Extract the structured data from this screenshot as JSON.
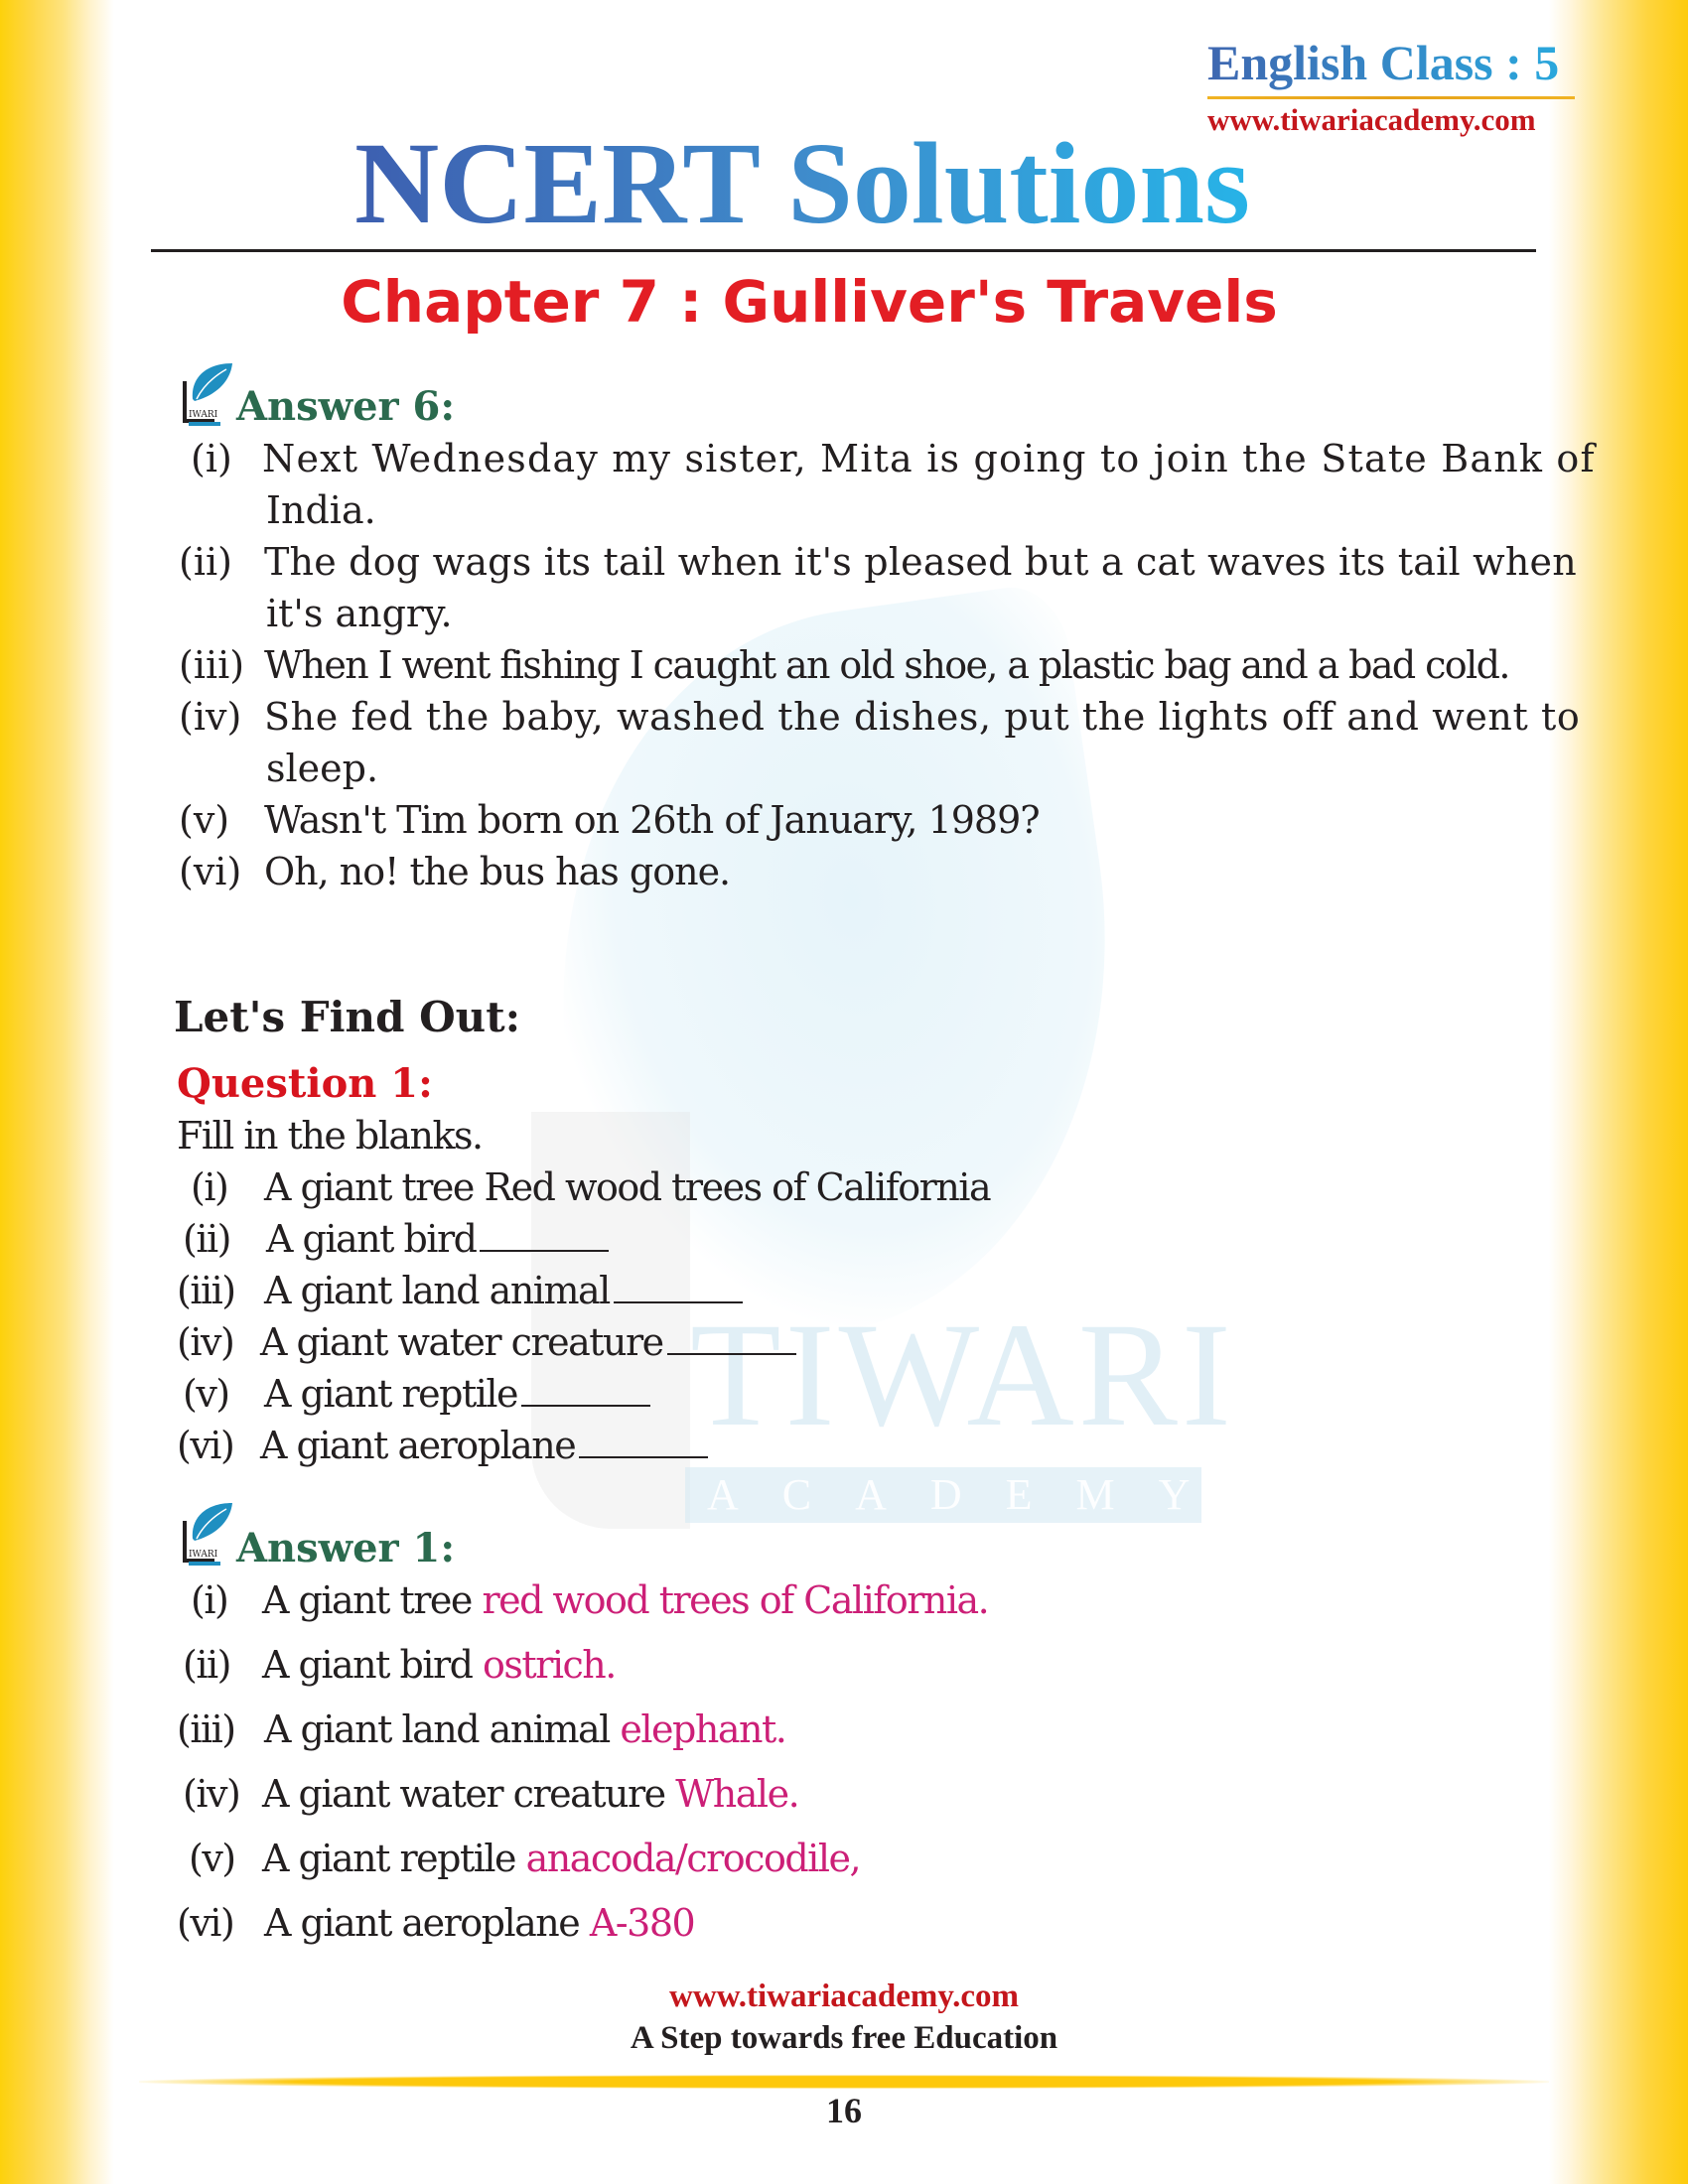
{
  "header": {
    "class_label": "English Class : 5",
    "website": "www.tiwariacademy.com",
    "title": "NCERT Solutions",
    "chapter": "Chapter 7 : Gulliver's Travels"
  },
  "answer6": {
    "heading": "Answer 6:",
    "logo_label": "TIWARI",
    "items": [
      {
        "num": "(i)",
        "line1": "Next Wednesday my sister, Mita is going to join the State Bank of",
        "line2": "India."
      },
      {
        "num": "(ii)",
        "line1": "The dog wags its tail when it's pleased but a cat waves its tail when",
        "line2": "it's angry."
      },
      {
        "num": "(iii)",
        "line1": "When I went fishing I caught an old shoe, a plastic bag and a bad cold."
      },
      {
        "num": "(iv)",
        "line1": "She fed the baby, washed the dishes, put the lights off and went to",
        "line2": "sleep."
      },
      {
        "num": "(v)",
        "line1": "Wasn't Tim born on 26th of January, 1989?"
      },
      {
        "num": "(vi)",
        "line1": "Oh, no! the bus has gone."
      }
    ]
  },
  "lets_find_out": {
    "heading": "Let's Find Out:",
    "question_heading": "Question 1:",
    "instruction": "Fill in the blanks.",
    "items": [
      {
        "num": "(i)",
        "text": "A giant tree Red wood trees of California",
        "blank": false
      },
      {
        "num": "(ii)",
        "text": "A giant bird",
        "blank": true
      },
      {
        "num": "(iii)",
        "text": "A giant land animal",
        "blank": true
      },
      {
        "num": "(iv)",
        "text": "A giant water creature",
        "blank": true
      },
      {
        "num": "(v)",
        "text": "A giant reptile",
        "blank": true
      },
      {
        "num": "(vi)",
        "text": "A giant aeroplane",
        "blank": true
      }
    ]
  },
  "answer1": {
    "heading": "Answer 1:",
    "logo_label": "TIWARI",
    "items": [
      {
        "num": "(i)",
        "prompt": "A giant tree",
        "answer": "red wood trees of California."
      },
      {
        "num": "(ii)",
        "prompt": "A giant bird",
        "answer": "ostrich."
      },
      {
        "num": "(iii)",
        "prompt": "A giant land animal",
        "answer": "elephant."
      },
      {
        "num": "(iv)",
        "prompt": "A giant water creature",
        "answer": "Whale."
      },
      {
        "num": "(v)",
        "prompt": "A giant reptile",
        "answer": "anacoda/crocodile,"
      },
      {
        "num": "(vi)",
        "prompt": "A giant aeroplane",
        "answer": "A-380"
      }
    ]
  },
  "watermark": {
    "word1": "TIWARI",
    "word2": "ACADEMY"
  },
  "footer": {
    "website": "www.tiwariacademy.com",
    "tagline": "A Step towards free Education",
    "page_number": "16"
  },
  "colors": {
    "answer_text": "#cc1f77",
    "answer_heading": "#2b6a4e",
    "question_heading": "#d7141e",
    "chapter": "#e31e24",
    "edge": "#fdd10b"
  }
}
